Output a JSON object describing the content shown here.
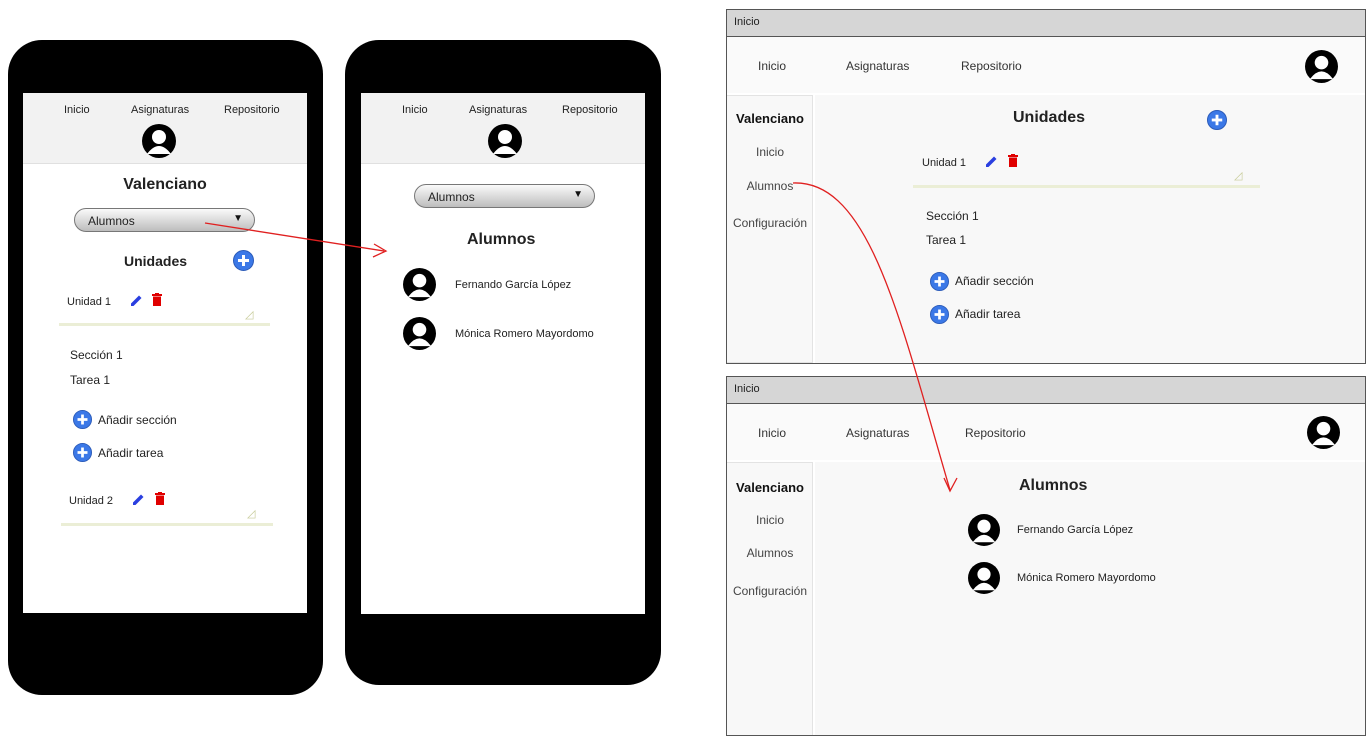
{
  "nav": {
    "inicio": "Inicio",
    "asignaturas": "Asignaturas",
    "repositorio": "Repositorio"
  },
  "course": {
    "title": "Valenciano"
  },
  "select": {
    "value": "Alumnos",
    "arrow": "▼"
  },
  "units": {
    "title": "Unidades",
    "unit1": "Unidad 1",
    "unit2": "Unidad 2",
    "section": "Sección 1",
    "task": "Tarea 1",
    "add_section": "Añadir sección",
    "add_task": "Añadir tarea"
  },
  "students": {
    "title": "Alumnos",
    "list": [
      "Fernando García López",
      "Mónica Romero Mayordomo"
    ]
  },
  "window": {
    "title": "Inicio"
  },
  "sidebar": {
    "course": "Valenciano",
    "inicio": "Inicio",
    "alumnos": "Alumnos",
    "config": "Configuración"
  },
  "colors": {
    "edit": "#2a3fe0",
    "delete": "#e00000",
    "add": "#3b78e7",
    "arrow": "#e02020",
    "underline": "#ebeed6"
  }
}
